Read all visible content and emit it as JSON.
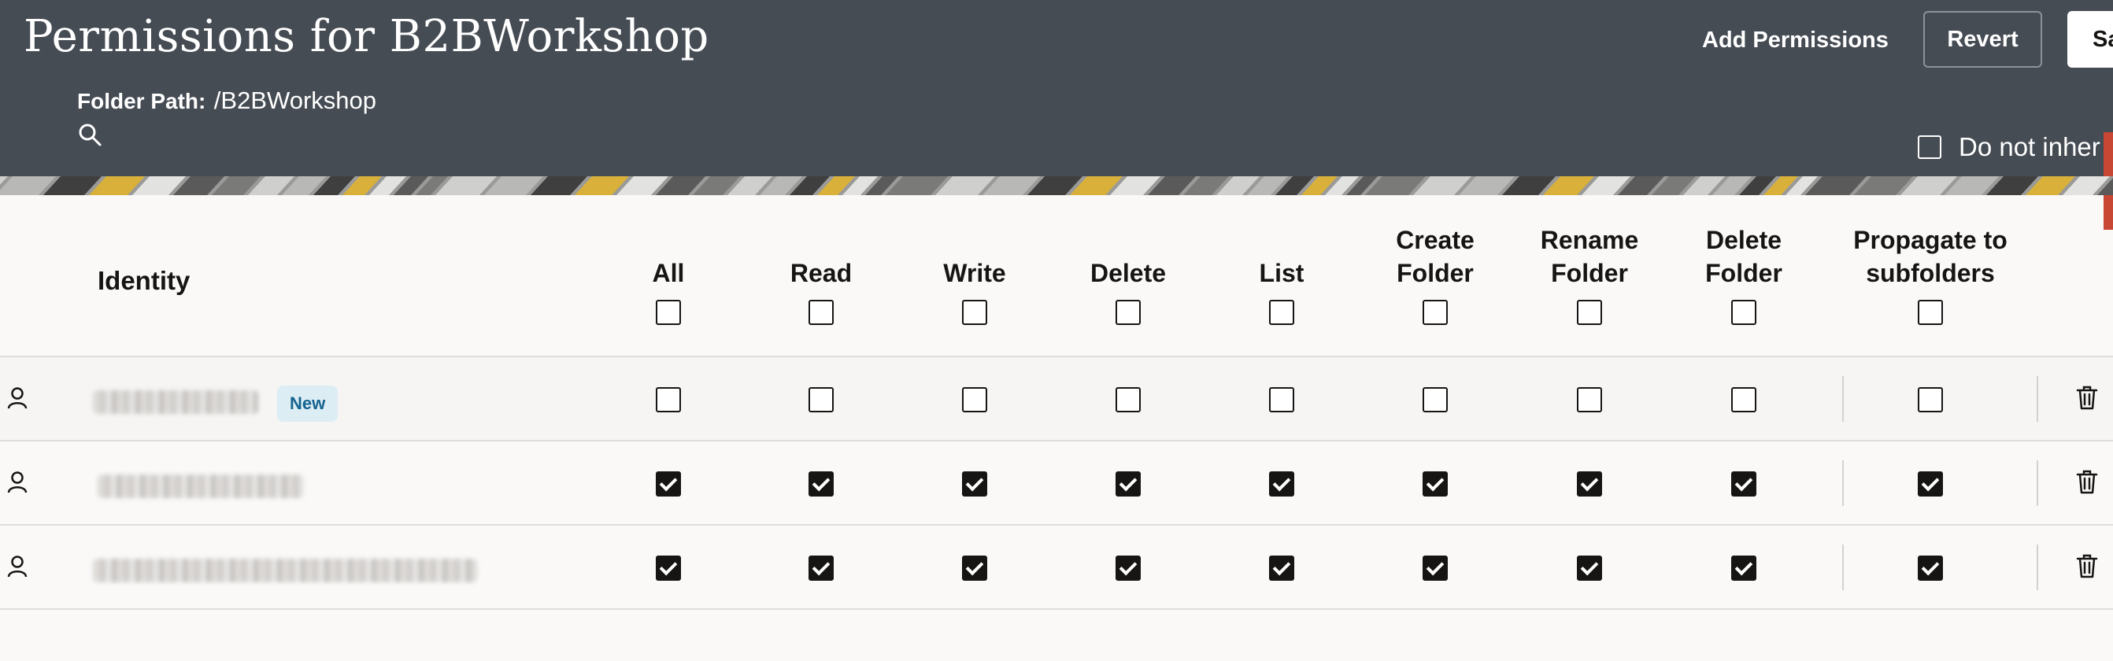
{
  "header": {
    "title": "Permissions for B2BWorkshop",
    "folder_path_label": "Folder Path:",
    "folder_path_value": "/B2BWorkshop",
    "add_permissions_label": "Add Permissions",
    "revert_label": "Revert",
    "save_label": "Sa",
    "do_not_inherit_label": "Do not inher",
    "do_not_inherit_checked": false
  },
  "colors": {
    "header_bg": "#464c54",
    "accent_red": "#c74634",
    "badge_bg": "#dcedf4",
    "badge_text": "#15638f"
  },
  "table": {
    "identity_header": "Identity",
    "columns": [
      {
        "key": "all",
        "line1": "",
        "line2": "All"
      },
      {
        "key": "read",
        "line1": "",
        "line2": "Read"
      },
      {
        "key": "write",
        "line1": "",
        "line2": "Write"
      },
      {
        "key": "delete",
        "line1": "",
        "line2": "Delete"
      },
      {
        "key": "list",
        "line1": "",
        "line2": "List"
      },
      {
        "key": "create_folder",
        "line1": "Create",
        "line2": "Folder"
      },
      {
        "key": "rename_folder",
        "line1": "Rename",
        "line2": "Folder"
      },
      {
        "key": "delete_folder",
        "line1": "Delete",
        "line2": "Folder"
      },
      {
        "key": "propagate",
        "line1": "Propagate to",
        "line2": "subfolders"
      }
    ],
    "header_checked": [
      false,
      false,
      false,
      false,
      false,
      false,
      false,
      false,
      false
    ],
    "rows": [
      {
        "badge": "New",
        "icon": "person-icon",
        "checked": [
          false,
          false,
          false,
          false,
          false,
          false,
          false,
          false,
          false
        ]
      },
      {
        "badge": "",
        "icon": "person-icon",
        "checked": [
          true,
          true,
          true,
          true,
          true,
          true,
          true,
          true,
          true
        ]
      },
      {
        "badge": "",
        "icon": "person-icon",
        "checked": [
          true,
          true,
          true,
          true,
          true,
          true,
          true,
          true,
          true
        ]
      }
    ]
  }
}
